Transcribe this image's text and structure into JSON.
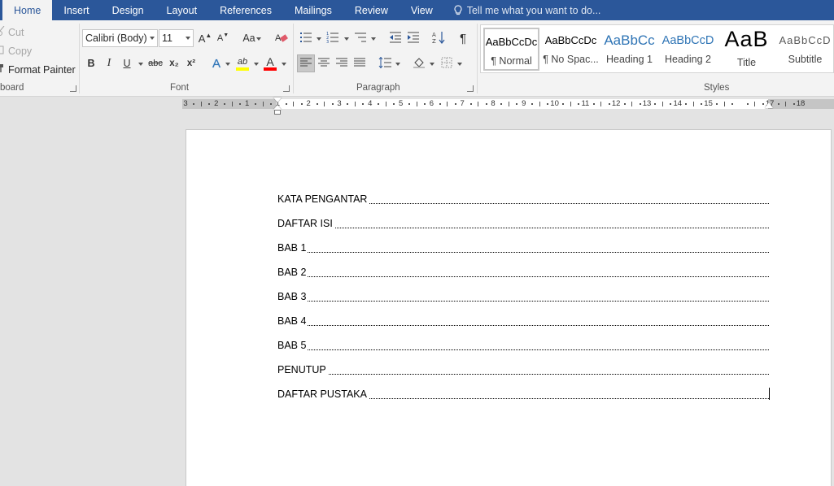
{
  "tabs": [
    {
      "label": "Home",
      "active": true
    },
    {
      "label": "Insert"
    },
    {
      "label": "Design"
    },
    {
      "label": "Layout"
    },
    {
      "label": "References"
    },
    {
      "label": "Mailings"
    },
    {
      "label": "Review"
    },
    {
      "label": "View"
    }
  ],
  "tell_me": {
    "placeholder": "Tell me what you want to do..."
  },
  "clipboard": {
    "cut_label": "Cut",
    "copy_label": "Copy",
    "format_painter_label": "Format Painter",
    "group_label": "board"
  },
  "font": {
    "family": "Calibri (Body)",
    "size": "11",
    "grow_icon": "A",
    "shrink_icon": "A",
    "change_case_icon": "Aa",
    "bold": "B",
    "italic": "I",
    "underline": "U",
    "strikethrough": "abc",
    "subscript": "x₂",
    "superscript": "x²",
    "text_effects": "A",
    "highlight": "ab",
    "font_color": "A",
    "group_label": "Font",
    "highlight_color": "#ffff00",
    "font_color_value": "#ff0000"
  },
  "paragraph": {
    "show_marks_icon": "¶",
    "group_label": "Paragraph"
  },
  "styles": {
    "group_label": "Styles",
    "items": [
      {
        "preview": "AaBbCcDc",
        "name": "¶ Normal",
        "active": true
      },
      {
        "preview": "AaBbCcDc",
        "name": "¶ No Spac..."
      },
      {
        "preview": "AaBbCc",
        "name": "Heading 1",
        "color": "#2e74b5"
      },
      {
        "preview": "AaBbCcD",
        "name": "Heading 2",
        "color": "#2e74b5"
      },
      {
        "preview": "AaB",
        "name": "Title"
      },
      {
        "preview": "AaBbCcD",
        "name": "Subtitle",
        "color": "#595959"
      }
    ]
  },
  "ruler": {
    "numbers": [
      "3",
      "2",
      "1",
      "1",
      "2",
      "3",
      "4",
      "5",
      "6",
      "7",
      "8",
      "9",
      "10",
      "11",
      "12",
      "13",
      "14",
      "15",
      "",
      "17",
      "18"
    ]
  },
  "document": {
    "toc": [
      "KATA PENGANTAR",
      "DAFTAR ISI",
      "BAB 1",
      "BAB 2",
      "BAB 3",
      "BAB 4",
      "BAB 5",
      "PENUTUP",
      "DAFTAR PUSTAKA"
    ]
  },
  "colors": {
    "brand": "#2b579a",
    "ribbon": "#f3f3f3",
    "workspace": "#e3e3e3"
  }
}
